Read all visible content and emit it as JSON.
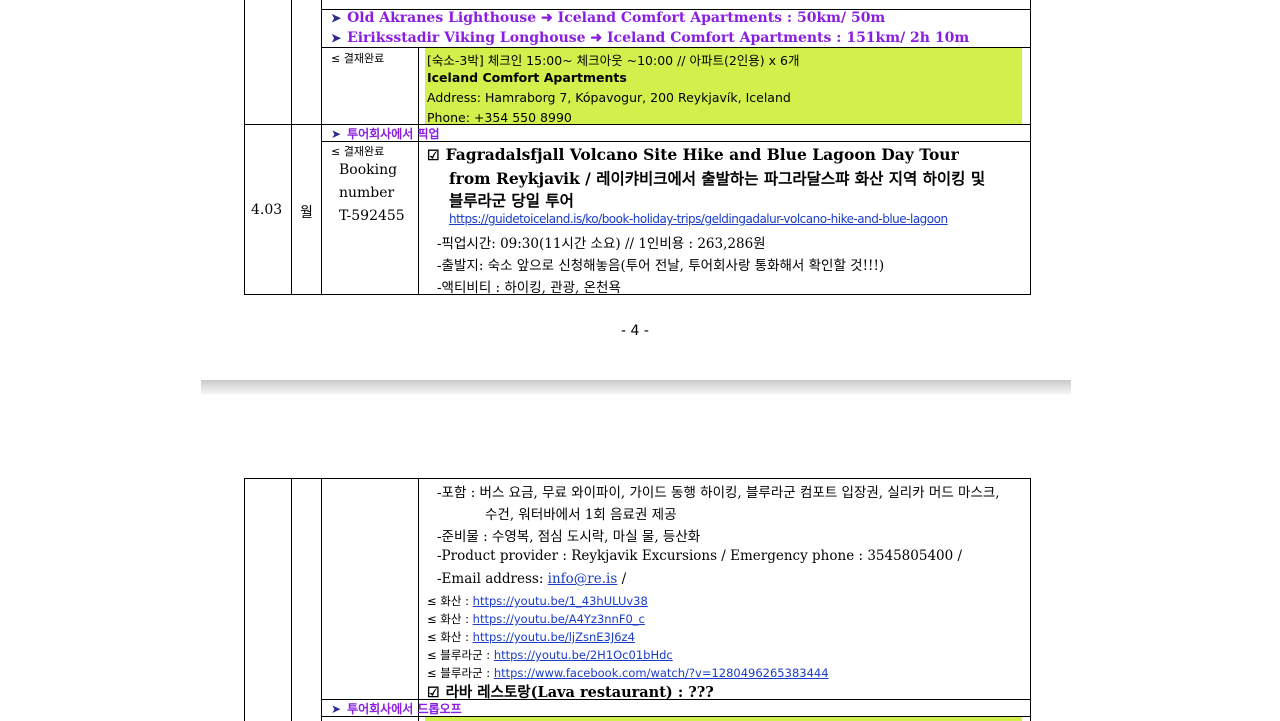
{
  "page_top": {
    "route_lines": [
      "Old Akranes Lighthouse ➜ Iceland Comfort Apartments : 50km/ 50m",
      "Eiriksstadir Viking Longhouse ➜ Iceland Comfort Apartments : 151km/ 2h 10m"
    ],
    "payment_label": "결재완료",
    "lodging": {
      "line1": "[숙소-3박] 체크인 15:00~ 체크아웃 ~10:00 // 아파트(2인용) x 6개",
      "name": "Iceland Comfort Apartments",
      "address": "Address: Hamraborg 7, Kópavogur, 200 Reykjavík, Iceland",
      "phone": "Phone: +354 550 8990"
    },
    "pickup_header": "투어회사에서 픽업",
    "date": "4.03",
    "weekday": "월",
    "booking_label_1": "Booking",
    "booking_label_2": "number",
    "booking_number": "T-592455",
    "tour_title_1": "Fagradalsfjall Volcano Site Hike and Blue Lagoon Day Tour",
    "tour_title_2": "from Reykjavik / 레이캬비크에서 출발하는 파그라달스퍄 화산 지역 하이킹 및",
    "tour_title_3": "블루라군 당일 투어",
    "tour_link": "https://guidetoiceland.is/ko/book-holiday-trips/geldingadalur-volcano-hike-and-blue-lagoon",
    "pickup_time": "-픽업시간: 09:30(11시간 소요) // 1인비용 : 263,286원",
    "departure": "-출발지: 숙소 앞으로 신청해놓음(투어 전날, 투어회사랑 통화해서 확인할 것!!!)",
    "activity": "-액티비티 : 하이킹, 관광, 온천욕",
    "page_number": "- 4 -"
  },
  "page_bottom": {
    "includes_1": "-포함 : 버스 요금, 무료 와이파이, 가이드 동행 하이킹, 블루라군 컴포트 입장권, 실리카 머드 마스크,",
    "includes_2": "수건, 워터바에서 1회 음료권 제공",
    "prepare": "-준비물 : 수영복, 점심 도시락, 마실 물, 등산화",
    "provider": "-Product provider : Reykjavik Excursions / Emergency phone : 3545805400 /",
    "email_label": "-Email address: ",
    "email": "info@re.is",
    "email_suffix": " /",
    "videos": [
      {
        "label": "화산 : ",
        "url": "https://youtu.be/1_43hULUv38"
      },
      {
        "label": "화산 : ",
        "url": "https://youtu.be/A4Yz3nnF0_c"
      },
      {
        "label": "화산 : ",
        "url": "https://youtu.be/ljZsnE3J6z4"
      },
      {
        "label": "블루라군 : ",
        "url": "https://youtu.be/2H1Oc01bHdc"
      },
      {
        "label": "블루라군 : ",
        "url": "https://www.facebook.com/watch/?v=1280496265383444"
      }
    ],
    "lava_restaurant": "라바 레스토랑(Lava restaurant) : ???",
    "dropoff_header": "투어회사에서 드롭오프"
  }
}
